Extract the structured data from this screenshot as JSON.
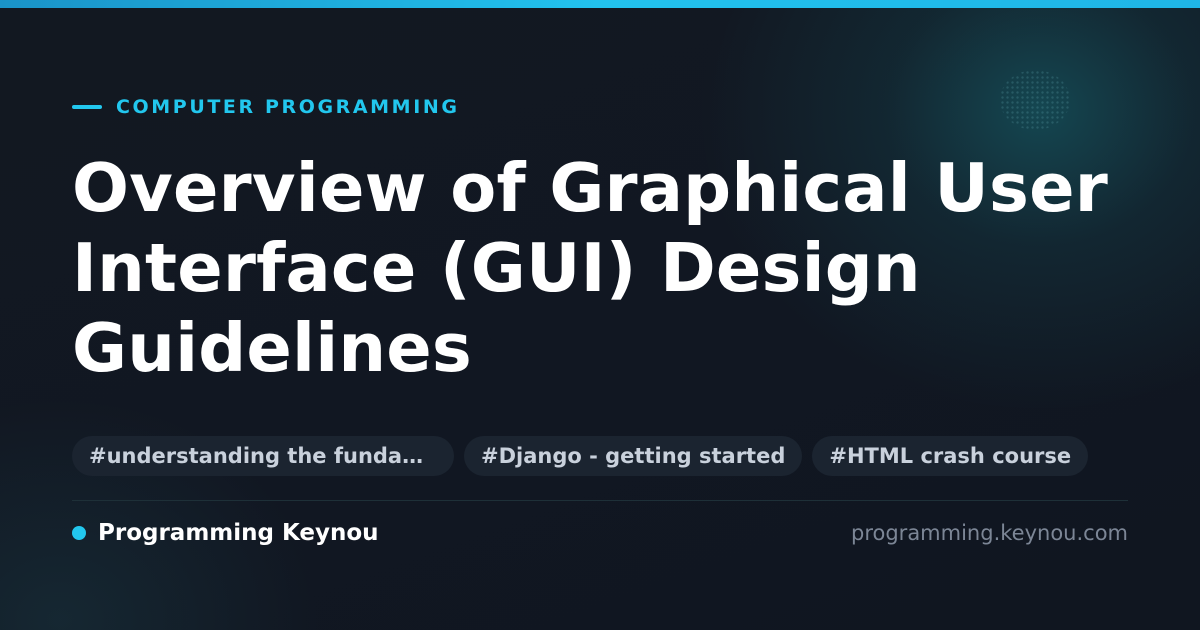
{
  "colors": {
    "accent": "#22c7ee",
    "background": "#111722",
    "title": "#ffffff",
    "tag_background": "#1b2430",
    "tag_text": "#c9d1dc",
    "muted_text": "#7c8696"
  },
  "header": {
    "category": "COMPUTER PROGRAMMING"
  },
  "main": {
    "title": "Overview of Graphical User Interface (GUI) Design Guidelines"
  },
  "tags": [
    {
      "label": "#understanding the fundamentals"
    },
    {
      "label": "#Django - getting started"
    },
    {
      "label": "#HTML crash course"
    }
  ],
  "footer": {
    "brand": "Programming Keynou",
    "url": "programming.keynou.com",
    "brand_icon": "dot-icon"
  }
}
